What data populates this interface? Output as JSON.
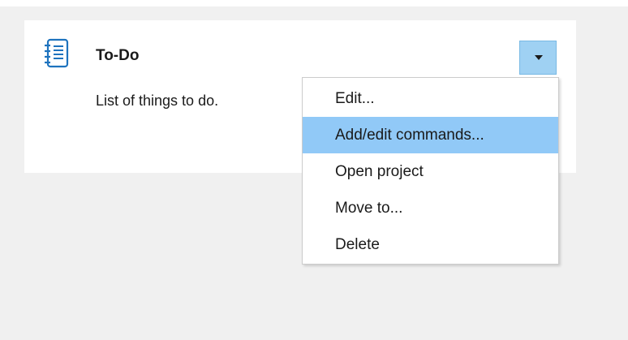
{
  "card": {
    "title": "To-Do",
    "description": "List of things to do.",
    "icon": "notebook-icon"
  },
  "dropdown": {
    "icon": "chevron-down-icon"
  },
  "menu": {
    "items": [
      {
        "label": "Edit..."
      },
      {
        "label": "Add/edit commands...",
        "highlighted": true
      },
      {
        "label": "Open project"
      },
      {
        "label": "Move to..."
      },
      {
        "label": "Delete"
      }
    ]
  },
  "colors": {
    "highlight": "#91c9f7",
    "button": "#9fd1f3",
    "icon": "#1e73be"
  }
}
